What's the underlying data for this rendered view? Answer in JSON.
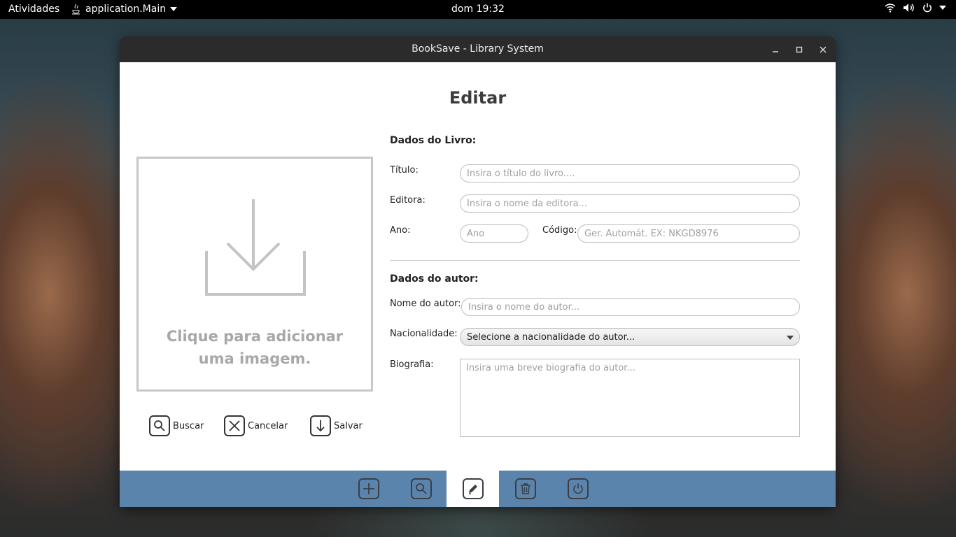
{
  "topbar": {
    "activities": "Atividades",
    "app_name": "application.Main",
    "clock": "dom 19:32"
  },
  "window": {
    "title": "BookSave - Library System"
  },
  "page": {
    "title": "Editar"
  },
  "image_panel": {
    "text": "Clique para adicionar uma imagem.",
    "icon": "download-tray-icon"
  },
  "actions": {
    "search": "Buscar",
    "cancel": "Cancelar",
    "save": "Salvar"
  },
  "book_section": {
    "title": "Dados do Livro:",
    "title_label": "Título:",
    "title_placeholder": "Insira o título do livro....",
    "publisher_label": "Editora:",
    "publisher_placeholder": "Insira o nome da editora...",
    "year_label": "Ano:",
    "year_placeholder": "Ano",
    "code_label": "Código:",
    "code_placeholder": "Ger. Automát. EX: NKGD8976"
  },
  "author_section": {
    "title": "Dados do autor:",
    "name_label": "Nome do autor:",
    "name_placeholder": "Insira o nome do autor...",
    "nationality_label": "Nacionalidade:",
    "nationality_value": "Selecione a nacionalidade do autor...",
    "bio_label": "Biografia:",
    "bio_placeholder": "Insira uma breve biografia do autor..."
  },
  "toolbar": {
    "items": [
      "add-icon",
      "search-icon",
      "edit-icon",
      "trash-icon",
      "power-icon"
    ],
    "active": "edit-icon",
    "color": "#5b84ad"
  }
}
